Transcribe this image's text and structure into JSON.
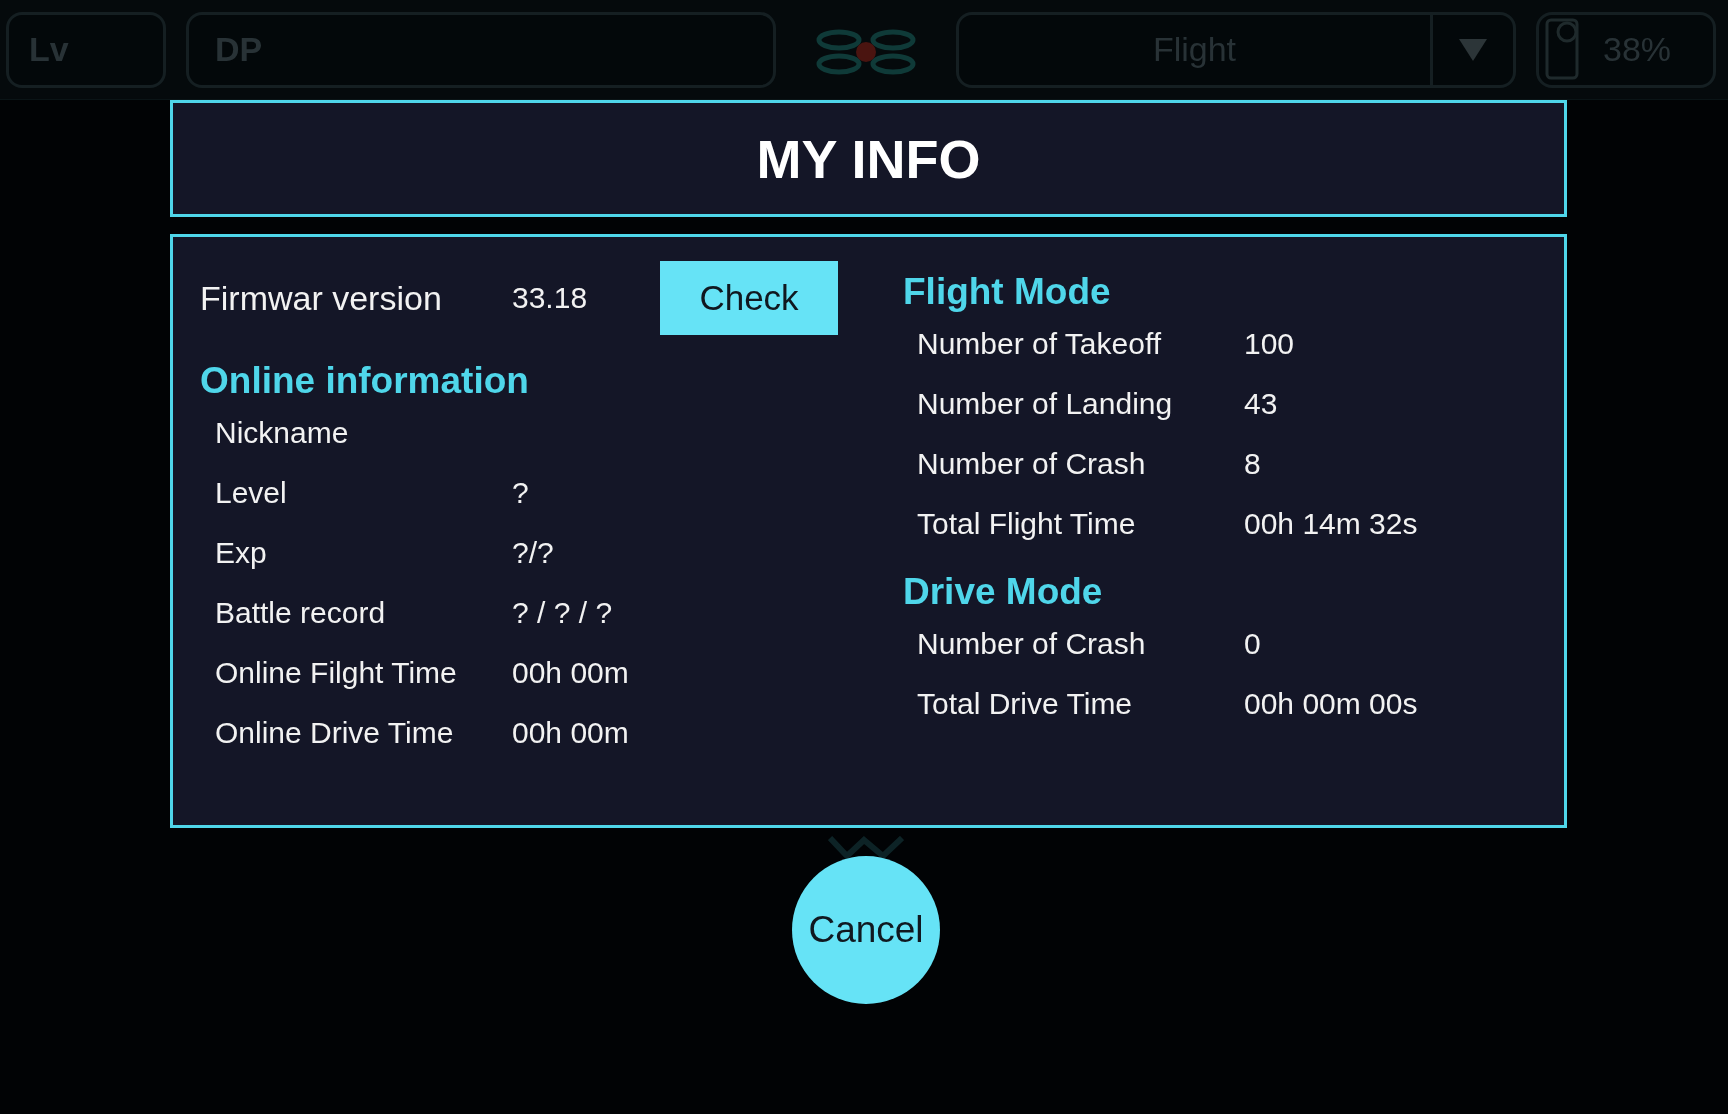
{
  "top_bar": {
    "level_label": "Lv",
    "dp_label": "DP",
    "mode": "Flight",
    "battery": "38%"
  },
  "dialog": {
    "title": "MY INFO",
    "firmware": {
      "label": "Firmwar version",
      "value": "33.18",
      "button": "Check"
    },
    "online_information": {
      "title": "Online information",
      "rows": [
        {
          "label": "Nickname"
        },
        {
          "label": "Level",
          "value": "?"
        },
        {
          "label": "Exp",
          "value": "?/?"
        },
        {
          "label": "Battle record",
          "value": "? / ? / ?"
        },
        {
          "label": "Online Filght Time",
          "value": "00h 00m"
        },
        {
          "label": "Online Drive Time",
          "value": "00h 00m"
        }
      ]
    },
    "flight_mode": {
      "title": "Flight Mode",
      "rows": [
        {
          "label": "Number of Takeoff",
          "value": "100"
        },
        {
          "label": "Number of Landing",
          "value": "43"
        },
        {
          "label": "Number of Crash",
          "value": "8"
        },
        {
          "label": "Total Flight Time",
          "value": "00h 14m 32s"
        }
      ]
    },
    "drive_mode": {
      "title": "Drive Mode",
      "rows": [
        {
          "label": "Number of Crash",
          "value": "0"
        },
        {
          "label": "Total Drive Time",
          "value": "00h 00m 00s"
        }
      ]
    }
  },
  "cancel_button": "Cancel"
}
